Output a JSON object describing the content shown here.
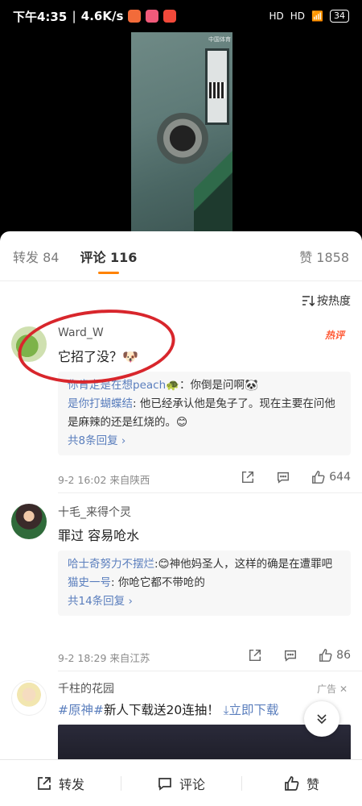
{
  "status_bar": {
    "time": "下午4:35",
    "speed": "4.6K/s",
    "battery": "34",
    "signal_a": "HD",
    "signal_b": "HD"
  },
  "video": {
    "watermark": "中国体育"
  },
  "tabs": {
    "repost": "转发 84",
    "comments": "评论 116",
    "likes": "赞 1858"
  },
  "sort_label": "按热度",
  "comments": [
    {
      "author": "Ward_W",
      "text": "它招了没？🐶",
      "badge": "热评",
      "replies": [
        {
          "name": "你肯定是在想peach",
          "text": "🐢：你倒是问啊🐼"
        },
        {
          "name": "是你打蝴蝶结",
          "text": ": 他已经承认他是兔子了。现在主要在问他是麻辣的还是红烧的。😊"
        }
      ],
      "more": "共8条回复 ›",
      "meta": "9-2 16:02  来自陕西",
      "likes": "644"
    },
    {
      "author": "十毛_来得个灵",
      "text": "罪过 容易呛水",
      "replies": [
        {
          "name": "哈士奇努力不摆烂",
          "text": ":😊神他妈圣人，这样的确是在遭罪吧"
        },
        {
          "name": "猫史一号",
          "text": ": 你呛它都不带呛的"
        }
      ],
      "more": "共14条回复 ›",
      "meta": "9-2 18:29  来自江苏",
      "likes": "86"
    }
  ],
  "ad": {
    "author": "千柱的花园",
    "tag": "广告",
    "topic": "#原神#",
    "text": "新人下载送20连抽！",
    "download": "⤓立即下载"
  },
  "bottom_bar": {
    "repost": "转发",
    "comment": "评论",
    "like": "赞"
  }
}
